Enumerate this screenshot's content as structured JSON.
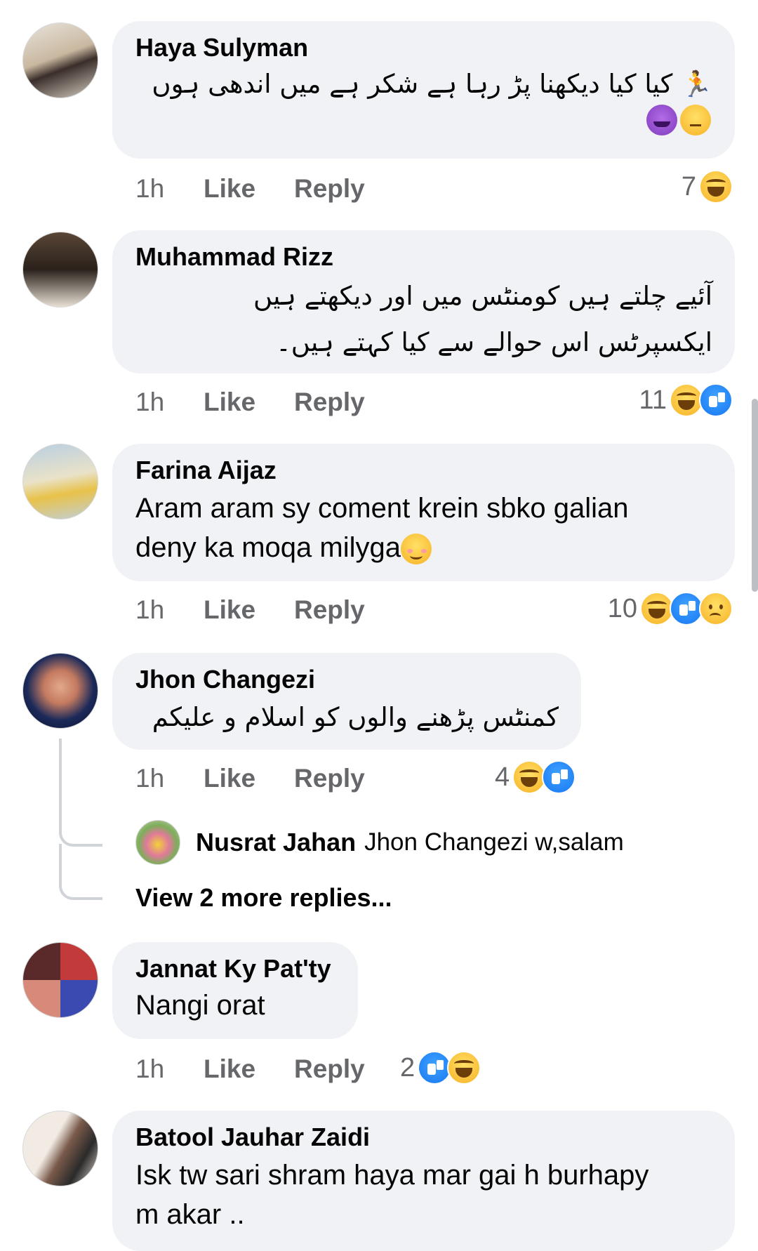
{
  "comments": [
    {
      "author": "Haya Sulyman",
      "text_line1": "کیا کیا دیکھنا پڑ رہا ہے شکر ہے میں اندھی ہوں",
      "time": "1h",
      "like": "Like",
      "reply": "Reply",
      "reaction_count": "7",
      "reactions": [
        "haha"
      ],
      "emoji_icons": [
        "person-running-icon",
        "smiling-devil-icon",
        "unamused-face-icon"
      ]
    },
    {
      "author": "Muhammad Rizz",
      "text_line1": "آئیے چلتے ہیں کومنٹس میں اور دیکھتے ہیں",
      "text_line2": "ایکسپرٹس اس حوالے سے کیا کہتے ہیں۔",
      "time": "1h",
      "like": "Like",
      "reply": "Reply",
      "reaction_count": "11",
      "reactions": [
        "haha",
        "like"
      ]
    },
    {
      "author": "Farina Aijaz",
      "text_line1": "Aram aram sy coment krein sbko galian",
      "text_line2": "deny ka moqa milyga",
      "emoji_icons": [
        "smiling-face-blush-icon"
      ],
      "time": "1h",
      "like": "Like",
      "reply": "Reply",
      "reaction_count": "10",
      "reactions": [
        "haha",
        "like",
        "sad"
      ]
    },
    {
      "author": "Jhon Changezi",
      "text_line1": "کمنٹس پڑھنے والوں کو اسلام و علیکم",
      "time": "1h",
      "like": "Like",
      "reply": "Reply",
      "reaction_count": "4",
      "reactions": [
        "haha",
        "like"
      ],
      "reply_preview": {
        "author": "Nusrat Jahan",
        "text": "Jhon Changezi w,salam"
      },
      "view_more": "View 2 more replies..."
    },
    {
      "author": "Jannat Ky Pat'ty",
      "text_line1": "Nangi orat",
      "time": "1h",
      "like": "Like",
      "reply": "Reply",
      "reaction_count": "2",
      "reactions": [
        "like",
        "haha"
      ]
    },
    {
      "author": "Batool Jauhar Zaidi",
      "text_line1": "Isk tw sari shram haya mar gai h burhapy",
      "text_line2": "m akar .."
    }
  ],
  "colors": {
    "bubble": "#f0f2f5",
    "secondary_text": "#65676b",
    "like_blue": "#1877f2",
    "haha_yellow": "#f7b125"
  }
}
